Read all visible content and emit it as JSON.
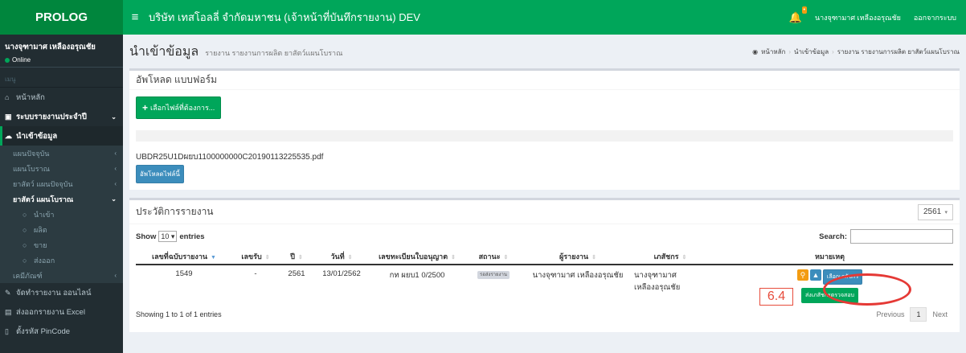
{
  "brand": "PROLOG",
  "app_title": "บริษัท เทสโอลลี่ จำกัดมหาชน (เจ้าหน้าที่บันทึกรายงาน) DEV",
  "top": {
    "user": "นางจุฑามาศ เหลืองอรุณชัย",
    "logout": "ออกจากระบบ"
  },
  "sidebar": {
    "user_name": "นางจุฑามาศ เหลืองอรุณชัย",
    "status": "Online",
    "menu_label": "เมนู",
    "home": "หน้าหลัก",
    "annual": "ระบบรายงานประจำปี",
    "import": "นำเข้าข้อมูล",
    "items": [
      "แผนปัจจุบัน",
      "แผนโบราณ",
      "ยาสัตว์ แผนปัจจุบัน",
      "ยาสัตว์ แผนโบราณ"
    ],
    "sub_items": [
      "นำเข้า",
      "ผลิต",
      "ขาย",
      "ส่งออก"
    ],
    "chem": "เคมีภัณฑ์",
    "online": "จัดทำรายงาน ออนไลน์",
    "excel": "ส่งออกรายงาน Excel",
    "pincode": "ตั้งรหัส PinCode"
  },
  "page": {
    "title": "นำเข้าข้อมูล",
    "subtitle": "รายงาน รายงานการผลิต ยาสัตว์แผนโบราณ",
    "breadcrumb": [
      "หน้าหลัก",
      "นำเข้าข้อมูล",
      "รายงาน รายงานการผลิต ยาสัตว์แผนโบราณ"
    ]
  },
  "upload": {
    "header": "อัพโหลด แบบฟอร์ม",
    "select_btn": "เลือกไฟล์ที่ต้องการ...",
    "file_name": "UBDR25U1Dผยบ1100000000C20190113225535.pdf",
    "upload_btn": "อัพโหลดไฟล์นี้"
  },
  "history": {
    "header": "ประวัติการรายงาน",
    "year": "2561",
    "show": "Show",
    "entries_value": "10",
    "entries": "entries",
    "search": "Search:",
    "columns": [
      "เลขที่ฉบับรายงาน",
      "เลขรับ",
      "ปี",
      "วันที่",
      "เลขทะเบียนใบอนุญาต",
      "สถานะ",
      "ผู้รายงาน",
      "เภสัชกร",
      "หมายเหตุ"
    ],
    "row": {
      "no": "1549",
      "recv": "-",
      "year": "2561",
      "date": "13/01/2562",
      "license": "กท ผยบ1 0/2500",
      "status": "รอส่งรายงาน",
      "reporter": "นางจุฑามาศ เหลืองอรุณชัย",
      "pharm_line1": "นางจุฑามาศ",
      "pharm_line2": "เหลืองอรุณชัย",
      "select_pharm": "เลือกเภสัชกร",
      "send_pharm": "ส่งเภสัชกรตรวจสอบ"
    },
    "info": "Showing 1 to 1 of 1 entries",
    "prev": "Previous",
    "page": "1",
    "next": "Next"
  },
  "annotation": "6.4",
  "colors": {
    "header_green": "#00a65a",
    "brand_green": "#00863d",
    "sidebar": "#222d32",
    "annotation_red": "#e53935"
  }
}
